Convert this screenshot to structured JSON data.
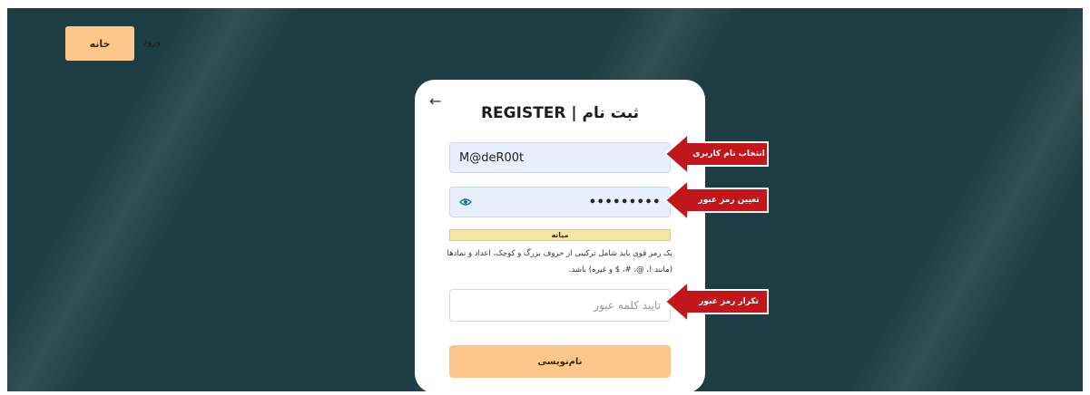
{
  "nav": {
    "home_label": "خانه",
    "login_label": "ورود"
  },
  "form": {
    "back_icon": "arrow-left-icon",
    "title": "REGISTER | ثبت نام",
    "username_value": "M@deR00t",
    "password_masked": "•••••••••",
    "strength_label": "میانه",
    "password_hint": "یک رمز قوی باید شامل ترکیبی از حروف بزرگ و کوچک، اعداد و نمادها (مانند !، @، #، $ و غیره) باشد.",
    "confirm_placeholder": "تایید کلمه عبور",
    "submit_label": "نام‌نویسی"
  },
  "annotations": [
    {
      "label": "انتخاب نام کاربری"
    },
    {
      "label": "تعیین رمز عبور"
    },
    {
      "label": "تکرار رمز عبور"
    }
  ],
  "colors": {
    "background": "#1d3d44",
    "accent": "#fcc78a",
    "callout": "#c0161c",
    "input_fill": "#e8effd",
    "strength_bar": "#f6e6a3"
  }
}
